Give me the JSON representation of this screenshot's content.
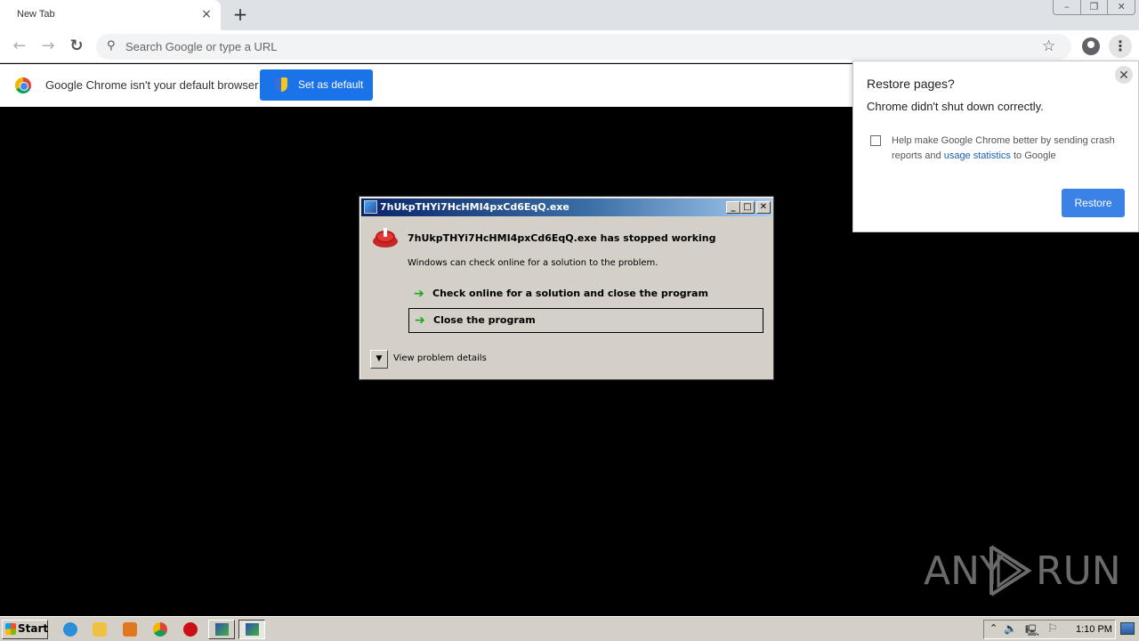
{
  "browser": {
    "tab": {
      "title": "New Tab",
      "close_icon": "×"
    },
    "new_tab_icon": "+",
    "window_controls": {
      "minimize": "–",
      "restore": "❐",
      "close": "✕"
    },
    "toolbar": {
      "back_icon": "←",
      "forward_icon": "→",
      "reload_icon": "↻",
      "search_icon": "⚲",
      "omnibox_placeholder": "Search Google or type a URL",
      "bookmark_icon": "☆",
      "menu_icon": "⋮"
    },
    "infobar": {
      "message": "Google Chrome isn't your default browser",
      "button_label": "Set as default"
    },
    "restore_popup": {
      "title": "Restore pages?",
      "subtitle": "Chrome didn't shut down correctly.",
      "close_icon": "✕",
      "help_text_before": "Help make Google Chrome better by sending crash reports and ",
      "help_link": "usage statistics",
      "help_text_after": " to Google",
      "checkbox_checked": false,
      "button_label": "Restore",
      "accent_color": "#3b82e6"
    }
  },
  "error_dialog": {
    "title": "7hUkpTHYi7HcHMI4pxCd6EqQ.exe",
    "controls": {
      "minimize": "_",
      "maximize": "□",
      "close": "✕"
    },
    "heading": "7hUkpTHYi7HcHMI4pxCd6EqQ.exe has stopped working",
    "message": "Windows can check online for a solution to the problem.",
    "options": [
      {
        "arrow_icon": "➔",
        "label": "Check online for a solution and close the program"
      },
      {
        "arrow_icon": "➔",
        "label": "Close the program"
      }
    ],
    "details_toggle_icon": "▼",
    "details_label": "View problem details"
  },
  "watermark": {
    "left": "ANY",
    "right": "RUN"
  },
  "taskbar": {
    "start_label": "Start",
    "tray": {
      "expand_icon": "⌃",
      "volume_icon": "🔈",
      "network_icon": "🖳",
      "flag_icon": "⚐",
      "clock": "1:10 PM"
    }
  }
}
